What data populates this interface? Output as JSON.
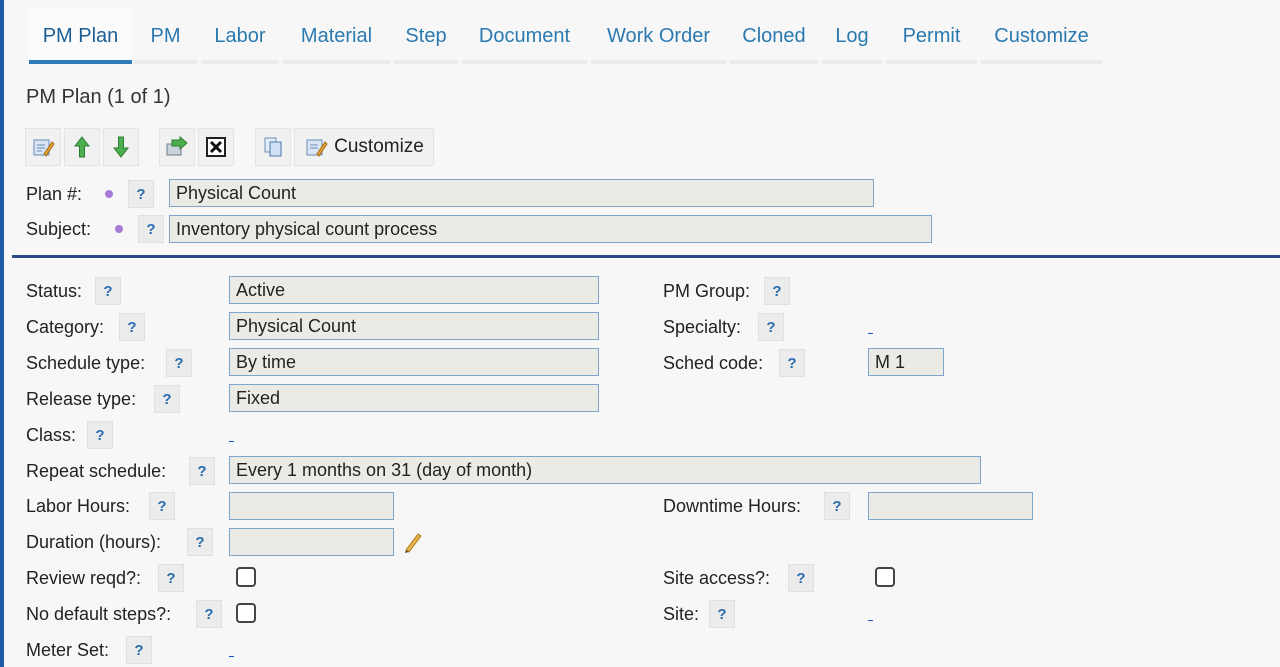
{
  "tabs": [
    "PM Plan",
    "PM",
    "Labor",
    "Material",
    "Step",
    "Document",
    "Work Order",
    "Cloned",
    "Log",
    "Permit",
    "Customize"
  ],
  "page_title": "PM Plan (1 of 1)",
  "toolbar": {
    "customize_label": "Customize"
  },
  "help_label": "?",
  "header": {
    "plan_label": "Plan #:",
    "plan_value": "Physical Count",
    "subject_label": "Subject:",
    "subject_value": "Inventory physical count process"
  },
  "form": {
    "status_label": "Status:",
    "status_value": "Active",
    "category_label": "Category:",
    "category_value": "Physical Count",
    "schedule_type_label": "Schedule type:",
    "schedule_type_value": "By time",
    "release_type_label": "Release type:",
    "release_type_value": "Fixed",
    "class_label": "Class:",
    "repeat_label": "Repeat schedule:",
    "repeat_value": "Every 1 months on 31 (day of month)",
    "labor_hours_label": "Labor Hours:",
    "labor_hours_value": "",
    "duration_label": "Duration (hours):",
    "duration_value": "",
    "review_label": "Review reqd?:",
    "review_checked": false,
    "no_default_steps_label": "No default steps?:",
    "no_default_steps_checked": false,
    "meter_set_label": "Meter Set:",
    "pm_group_label": "PM Group:",
    "specialty_label": "Specialty:",
    "sched_code_label": "Sched code:",
    "sched_code_value": "M 1",
    "downtime_label": "Downtime Hours:",
    "downtime_value": "",
    "site_access_label": "Site access?:",
    "site_access_checked": false,
    "site_label": "Site:"
  },
  "colors": {
    "accent": "#2c7bb6",
    "tab_text": "#2a7ab0",
    "required_dot": "#a57bd6",
    "divider": "#2a4a8a"
  }
}
